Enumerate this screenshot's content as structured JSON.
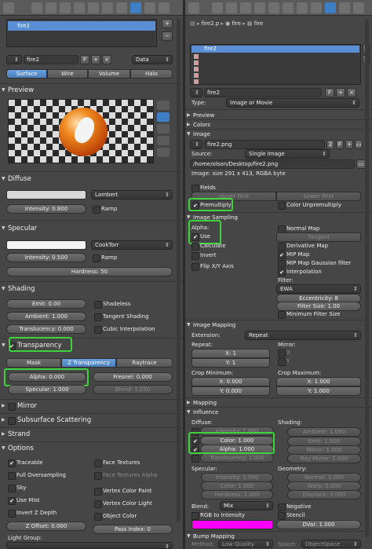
{
  "left": {
    "slot_name": "fire2",
    "material_name": "fire2",
    "material_user_tag": "F",
    "data_dropdown": "Data",
    "tabs": [
      "Surface",
      "Wire",
      "Volume",
      "Halo"
    ],
    "preview_header": "Preview",
    "diffuse": {
      "header": "Diffuse",
      "shader": "Lambert",
      "intensity": "Intensity: 0.800",
      "ramp": "Ramp"
    },
    "specular": {
      "header": "Specular",
      "shader": "CookTorr",
      "intensity": "Intensity: 0.500",
      "ramp": "Ramp",
      "hardness": "Hardness: 50"
    },
    "shading": {
      "header": "Shading",
      "emit": "Emit: 0.00",
      "ambient": "Ambient: 1.000",
      "translucency": "Translucency: 0.000",
      "shadeless": "Shadeless",
      "tangent": "Tangent Shading",
      "cubic": "Cubic Interpolation"
    },
    "transparency": {
      "header": "Transparency",
      "tabs": [
        "Mask",
        "Z Transparency",
        "Raytrace"
      ],
      "alpha": "Alpha: 0.000",
      "fresnel": "Fresnel: 0.000",
      "specular": "Specular: 1.000",
      "blend": "Blend: 1.250"
    },
    "mirror": "Mirror",
    "sss": "Subsurface Scattering",
    "strand": "Strand",
    "options": {
      "header": "Options",
      "left": [
        "Traceable",
        "Full Oversampling",
        "Sky",
        "Use Mist",
        "Invert Z Depth"
      ],
      "right": [
        "Face Textures",
        "Face Textures Alpha",
        "Vertex Color Paint",
        "Vertex Color Light",
        "Object Color"
      ],
      "z_offset": "Z Offset: 0.000",
      "pass_index": "Pass Index: 0",
      "light_group": "Light Group:"
    }
  },
  "right": {
    "breadcrumb": [
      "fire2.p",
      "fire",
      "fire"
    ],
    "slots": [
      "fire2",
      "",
      "",
      "",
      "",
      ""
    ],
    "texture_name": "fire2",
    "type_label": "Type:",
    "type_value": "Image or Movie",
    "sections": [
      "Preview",
      "Colors",
      "Image"
    ],
    "image_name": "fire2.png",
    "image_users": "2",
    "image_tag": "F",
    "source_label": "Source:",
    "source_value": "Single Image",
    "path": "/home/olson/Desktop/fire2.png",
    "image_info": "Image: size 291 x 413, RGBA byte",
    "fields_label": "Fields",
    "upper_first": "Upper First",
    "lower_first": "Lower First",
    "premultiply": "Premultiply",
    "color_unpremultiply": "Color Unpremultiply",
    "image_sampling": {
      "header": "Image Sampling",
      "alpha_label": "Alpha:",
      "use": "Use",
      "calculate": "Calculate",
      "invert": "Invert",
      "flip": "Flip X/Y Axis",
      "normal_map": "Normal Map",
      "tangent": "Tangent",
      "derivative_map": "Derivative Map",
      "mip_map": "MIP Map",
      "mip_gauss": "MIP Map Gaussian filter",
      "interpolation": "Interpolation",
      "filter_label": "Filter:",
      "filter_value": "EWA",
      "eccentricity": "Eccentricity: 8",
      "filter_size": "Filter Size: 1.00",
      "min_filter": "Minimum Filter Size"
    },
    "image_mapping": {
      "header": "Image Mapping",
      "extension_label": "Extension:",
      "extension_value": "Repeat",
      "repeat_label": "Repeat:",
      "rx": "X: 1",
      "ry": "Y: 1",
      "mirror_label": "Mirror:",
      "mx": "X",
      "my": "Y",
      "crop_min_label": "Crop Minimum:",
      "cminx": "X: 0.000",
      "cminy": "Y: 0.000",
      "crop_max_label": "Crop Maximum:",
      "cmaxx": "X: 1.000",
      "cmaxy": "Y: 1.000"
    },
    "mapping": "Mapping",
    "influence": {
      "header": "Influence",
      "diffuse_label": "Diffuse:",
      "intensity": "Intensity: 1.000",
      "color": "Color: 1.000",
      "alpha": "Alpha: 1.000",
      "translucency": "Translucency: 1.000",
      "shading_label": "Shading:",
      "ambient": "Ambient: 1.000",
      "emit": "Emit: 1.000",
      "mirror": "Mirror: 1.000",
      "ray_mirror": "Ray Mirror: 1.000",
      "specular_label": "Specular:",
      "sp_intensity": "Intensity: 1.000",
      "sp_color": "Color: 1.000",
      "sp_hardness": "Hardness: 1.000",
      "geometry_label": "Geometry:",
      "normal": "Normal: 1.000",
      "warp": "Warp: 0.000",
      "displace": "Displace: 0.000",
      "blend_label": "Blend:",
      "blend_value": "Mix",
      "negative": "Negative",
      "rgb_to_intensity": "RGB to Intensity",
      "stencil": "Stencil",
      "dvar": "DVar: 1.000",
      "bump_header": "Bump Mapping",
      "method_label": "Method:",
      "method_value": "Low Quality",
      "space_label": "Space:",
      "space_value": "ObjectSpace"
    }
  },
  "colors": {
    "highlight": "#3fd23f",
    "magenta": "#ff00ff",
    "accent": "#5a8fd6"
  }
}
